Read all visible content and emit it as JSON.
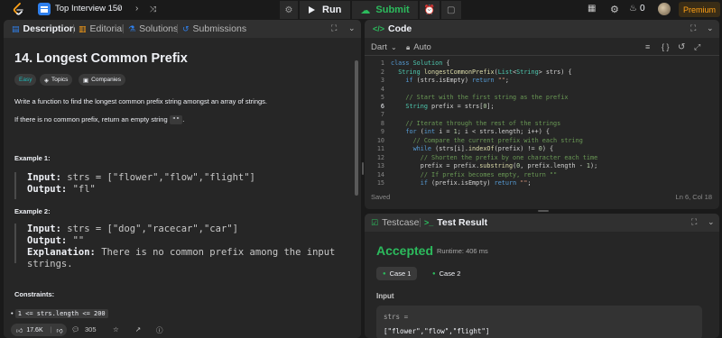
{
  "topbar": {
    "problem_list_title": "Top Interview 150",
    "run_label": "Run",
    "submit_label": "Submit",
    "streak_count": "0",
    "premium_label": "Premium"
  },
  "description_panel": {
    "tabs": [
      {
        "label": "Description"
      },
      {
        "label": "Editorial"
      },
      {
        "label": "Solutions"
      },
      {
        "label": "Submissions"
      }
    ],
    "title": "14. Longest Common Prefix",
    "tags": {
      "difficulty": "Easy",
      "topics": "Topics",
      "companies": "Companies"
    },
    "paragraph1": "Write a function to find the longest common prefix string amongst an array of strings.",
    "paragraph2_pre": "If there is no common prefix, return an empty string ",
    "paragraph2_code": "\"\"",
    "paragraph2_post": ".",
    "example1": {
      "title": "Example 1:",
      "input_label": "Input:",
      "input_value": "strs = [\"flower\",\"flow\",\"flight\"]",
      "output_label": "Output:",
      "output_value": "\"fl\""
    },
    "example2": {
      "title": "Example 2:",
      "input_label": "Input:",
      "input_value": "strs = [\"dog\",\"racecar\",\"car\"]",
      "output_label": "Output:",
      "output_value": "\"\"",
      "explanation_label": "Explanation:",
      "explanation_value": "There is no common prefix among the input strings."
    },
    "constraints_title": "Constraints:",
    "constraint1": "1 <= strs.length <= 200",
    "bottom": {
      "likes": "17.6K",
      "comments": "305"
    }
  },
  "code_panel": {
    "title": "Code",
    "language": "Dart",
    "auto_label": "Auto",
    "status": "Saved",
    "cursor": "Ln 6, Col 18",
    "highlighted_line": 6
  },
  "result_panel": {
    "tabs": [
      {
        "label": "Testcase"
      },
      {
        "label": "Test Result"
      }
    ],
    "verdict": "Accepted",
    "runtime": "Runtime: 406 ms",
    "cases": [
      {
        "label": "Case 1"
      },
      {
        "label": "Case 2"
      }
    ],
    "input_label": "Input",
    "var_name": "strs =",
    "var_value": "[\"flower\",\"flow\",\"flight\"]"
  },
  "colors": {
    "accent_orange": "#ffa116",
    "accepted_green": "#2cbb5d",
    "easy_teal": "#1cbaba",
    "tab_blue": "#2f80ed"
  }
}
